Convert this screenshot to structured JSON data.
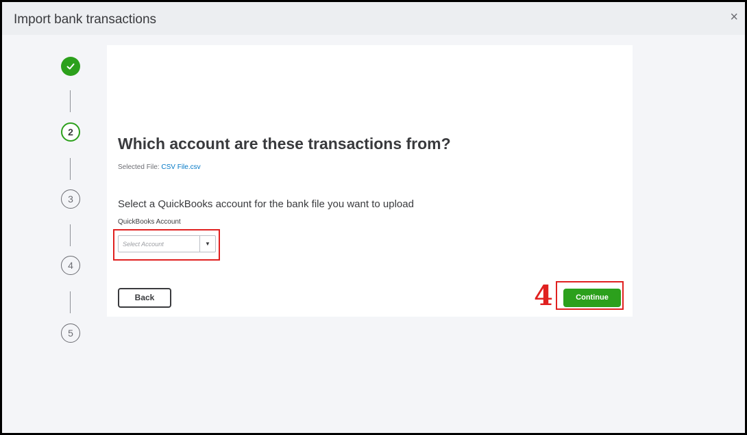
{
  "window": {
    "title": "Import bank transactions",
    "close_glyph": "×"
  },
  "stepper": {
    "steps": [
      {
        "label": "",
        "state": "done",
        "icon": "check-icon"
      },
      {
        "label": "2",
        "state": "current"
      },
      {
        "label": "3",
        "state": "future"
      },
      {
        "label": "4",
        "state": "future"
      },
      {
        "label": "5",
        "state": "future"
      }
    ]
  },
  "main": {
    "heading": "Which account are these transactions from?",
    "selected_file_label": "Selected File:",
    "selected_file_name": "CSV File.csv",
    "instruction": "Select a QuickBooks account for the bank file you want to upload",
    "account_field_label": "QuickBooks Account",
    "account_placeholder": "Select Account",
    "account_value": "",
    "dropdown_glyph": "▼",
    "back_label": "Back",
    "continue_label": "Continue"
  },
  "annotation": {
    "step_number": "4",
    "color": "#e0201f"
  },
  "colors": {
    "accent_green": "#2ca01c",
    "link_blue": "#0077c5",
    "text_dark": "#393a3d"
  }
}
